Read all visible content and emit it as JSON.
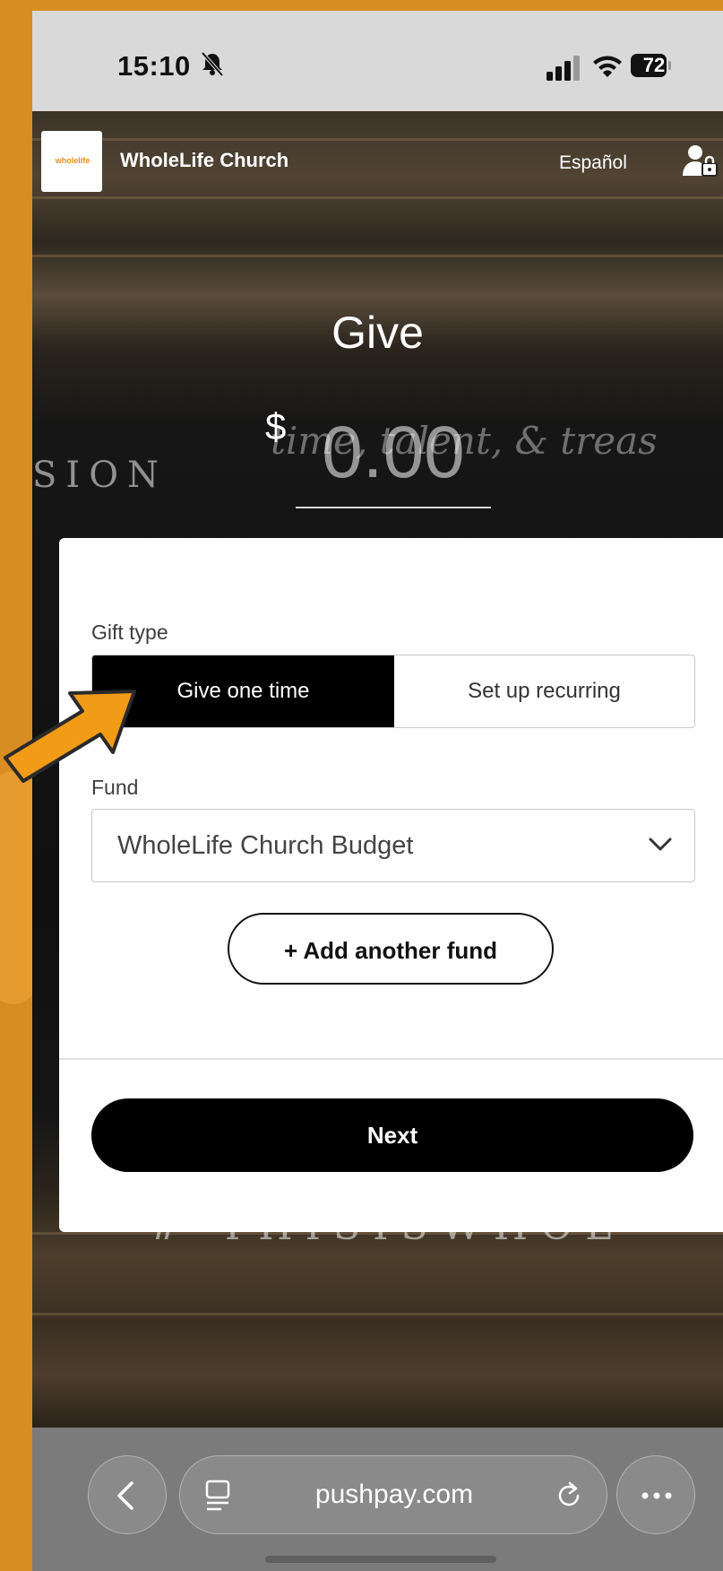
{
  "status_bar": {
    "time": "15:10",
    "battery": "72"
  },
  "header": {
    "org_name": "WholeLife Church",
    "logo_text": "wholelife",
    "language_link": "Español"
  },
  "background_text": {
    "mission": "SION",
    "chalk_phrase": "time, talent, & treas",
    "hashtag": "# THISISWHOL"
  },
  "give": {
    "title": "Give",
    "currency": "$",
    "amount_placeholder": "0.00"
  },
  "form": {
    "gift_type_label": "Gift type",
    "gift_type_options": [
      "Give one time",
      "Set up recurring"
    ],
    "fund_label": "Fund",
    "fund_selected": "WholeLife Church Budget",
    "add_fund_label": "+ Add another fund",
    "next_label": "Next"
  },
  "browser": {
    "url": "pushpay.com"
  },
  "colors": {
    "accent_arrow": "#f29b17",
    "background": "#d78d22",
    "primary_button": "#000000"
  }
}
